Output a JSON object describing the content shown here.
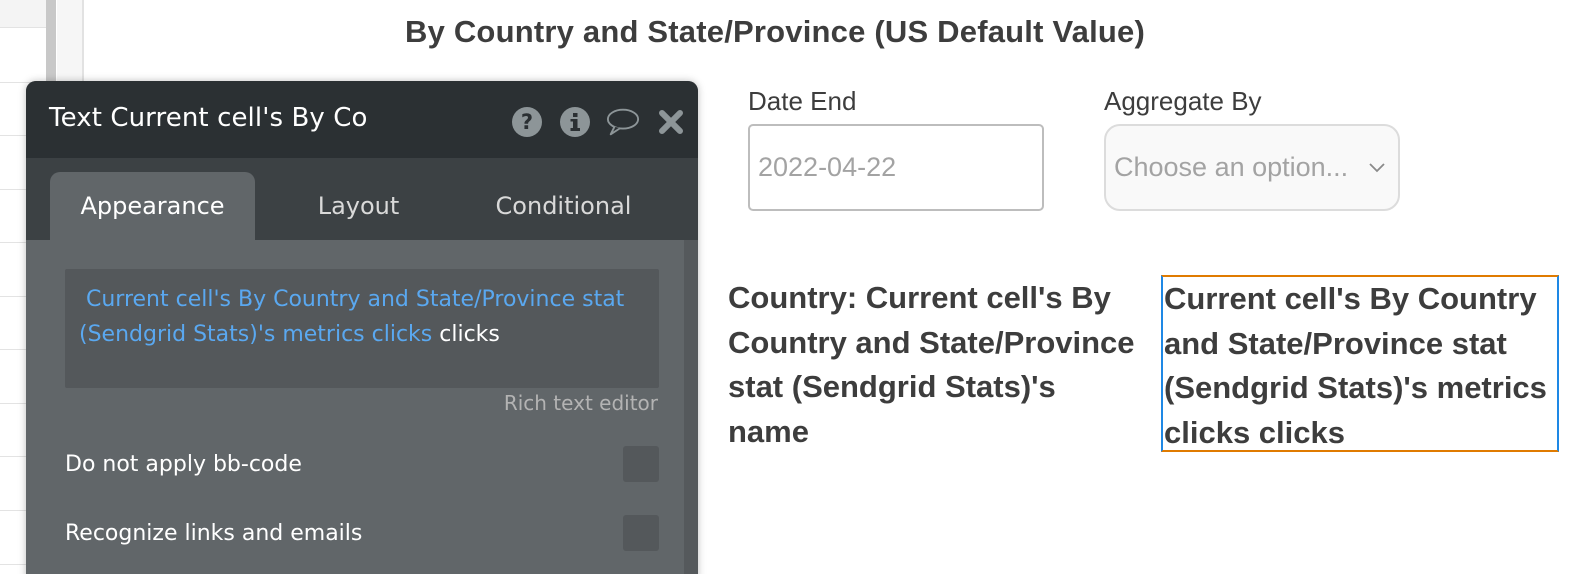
{
  "page": {
    "title": "By Country and State/Province (US Default Value)"
  },
  "filters": {
    "date_end": {
      "label": "Date End",
      "value": "2022-04-22"
    },
    "aggregate_by": {
      "label": "Aggregate By",
      "placeholder": "Choose an option...",
      "icon": "chevron-down-icon"
    }
  },
  "cells": {
    "country_text": "Country: Current cell's By Country and State/Province stat (Sendgrid Stats)'s name",
    "clicks_text": "Current cell's By Country and State/Province stat (Sendgrid Stats)'s metrics clicks clicks"
  },
  "panel": {
    "title": "Text Current cell's By Co",
    "icons": [
      "help-icon",
      "info-icon",
      "comment-icon",
      "close-icon"
    ],
    "tabs": [
      {
        "label": "Appearance",
        "active": true
      },
      {
        "label": "Layout",
        "active": false
      },
      {
        "label": "Conditional",
        "active": false
      }
    ],
    "rich_text": {
      "dynamic_part": "Current cell's By Country and State/Province stat (Sendgrid Stats)'s metrics clicks",
      "static_part": "clicks",
      "hint": "Rich text editor"
    },
    "options": [
      {
        "label": "Do not apply bb-code",
        "checked": false
      },
      {
        "label": "Recognize links and emails",
        "checked": false
      }
    ]
  },
  "colors": {
    "dynamic_expression": "#5aa8f0",
    "selection_border_orange": "#e07b00",
    "selection_border_blue": "#1e88e5",
    "panel_header": "#2b3033",
    "panel_body": "#616669"
  }
}
